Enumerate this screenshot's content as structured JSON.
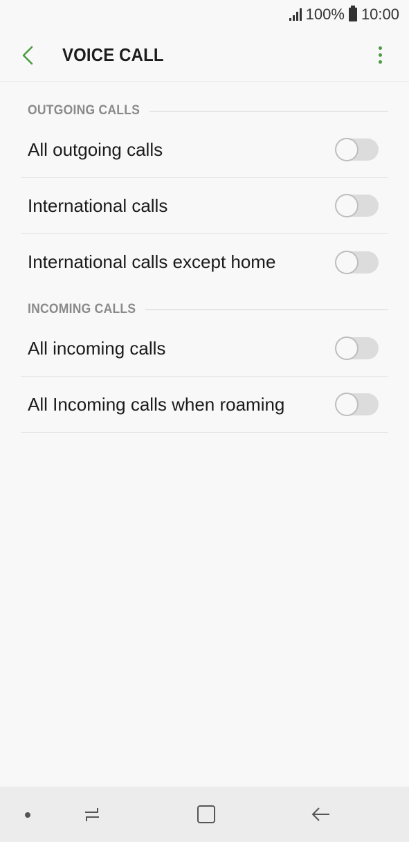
{
  "status_bar": {
    "battery": "100%",
    "time": "10:00"
  },
  "app_bar": {
    "title": "VOICE CALL",
    "back_icon": "chevron-left-icon",
    "more_icon": "more-vertical-icon",
    "accent_color": "#4a9a3f"
  },
  "sections": [
    {
      "header": "OUTGOING CALLS",
      "items": [
        {
          "label": "All outgoing calls",
          "enabled": false
        },
        {
          "label": "International calls",
          "enabled": false
        },
        {
          "label": "International calls except home",
          "enabled": false
        }
      ]
    },
    {
      "header": "INCOMING CALLS",
      "items": [
        {
          "label": "All incoming calls",
          "enabled": false
        },
        {
          "label": "All Incoming calls when roaming",
          "enabled": false
        }
      ]
    }
  ],
  "nav_bar": {
    "buttons": [
      "recent-apps-icon",
      "home-icon",
      "back-arrow-icon"
    ]
  }
}
